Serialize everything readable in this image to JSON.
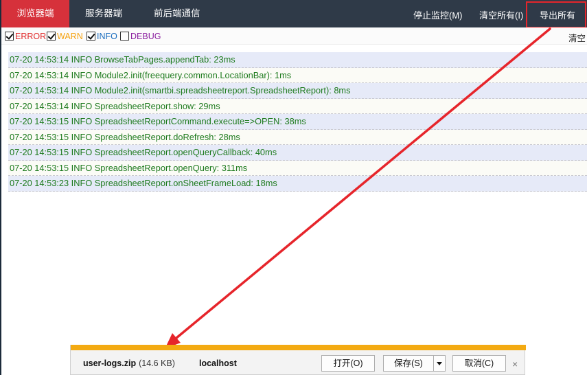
{
  "topbar": {
    "tabs": [
      {
        "label": "浏览器端"
      },
      {
        "label": "服务器端"
      },
      {
        "label": "前后端通信"
      }
    ],
    "actions": [
      {
        "label": "停止监控(M)"
      },
      {
        "label": "清空所有(I)"
      },
      {
        "label": "导出所有(X)"
      }
    ]
  },
  "filters": {
    "error": "ERROR",
    "warn": "WARN",
    "info": "INFO",
    "debug": "DEBUG",
    "clear": "清空"
  },
  "logs": [
    "07-20 14:53:14 INFO BrowseTabPages.appendTab: 23ms",
    "07-20 14:53:14 INFO Module2.init(freequery.common.LocationBar): 1ms",
    "07-20 14:53:14 INFO Module2.init(smartbi.spreadsheetreport.SpreadsheetReport): 8ms",
    "07-20 14:53:14 INFO SpreadsheetReport.show: 29ms",
    "07-20 14:53:15 INFO SpreadsheetReportCommand.execute=>OPEN: 38ms",
    "07-20 14:53:15 INFO SpreadsheetReport.doRefresh: 28ms",
    "07-20 14:53:15 INFO SpreadsheetReport.openQueryCallback: 40ms",
    "07-20 14:53:15 INFO SpreadsheetReport.openQuery: 311ms",
    "07-20 14:53:23 INFO SpreadsheetReport.onSheetFrameLoad: 18ms"
  ],
  "download": {
    "filename": "user-logs.zip",
    "size": "(14.6 KB)",
    "host": "localhost",
    "open": "打开(O)",
    "save": "保存(S)",
    "cancel": "取消(C)",
    "close": "×"
  },
  "colors": {
    "active_tab": "#d6313b",
    "topbar_bg": "#2f3a48",
    "highlight": "#e6252b",
    "log_text": "#1d7a1d",
    "progress": "#f3aa12"
  },
  "icons": [
    "checkbox-checked",
    "checkbox-unchecked",
    "dropdown-arrow-icon",
    "close-icon",
    "annotation-arrow"
  ]
}
